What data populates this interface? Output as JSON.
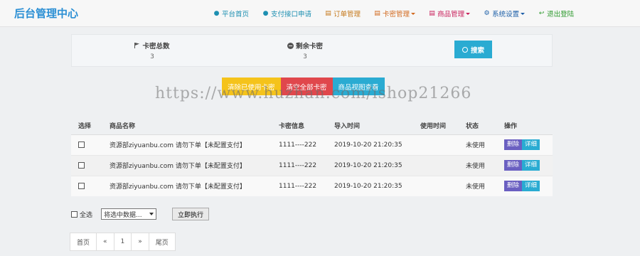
{
  "header": {
    "brand": "后台管理中心",
    "nav": [
      {
        "label": "平台首页",
        "icon": "user-icon",
        "color": "#1d8fb1",
        "dropdown": false
      },
      {
        "label": "支付接口申请",
        "icon": "user-icon",
        "color": "#1d8fb1",
        "dropdown": false
      },
      {
        "label": "订单管理",
        "icon": "order-list-icon",
        "color": "#c67a1d",
        "dropdown": false
      },
      {
        "label": "卡密管理",
        "icon": "card-list-icon",
        "color": "#d2691e",
        "dropdown": true
      },
      {
        "label": "商品管理",
        "icon": "goods-list-icon",
        "color": "#c81e5a",
        "dropdown": true
      },
      {
        "label": "系统设置",
        "icon": "gear-icon",
        "color": "#1d5fa8",
        "dropdown": true
      },
      {
        "label": "退出登陆",
        "icon": "logout-icon",
        "color": "#2d9a2d",
        "dropdown": false
      }
    ]
  },
  "stats": {
    "total": {
      "label": "卡密总数",
      "value": "3",
      "icon": "flag-icon"
    },
    "remaining": {
      "label": "剩余卡密",
      "value": "3",
      "icon": "minus-circle-icon"
    },
    "search_label": "搜索"
  },
  "actions": {
    "clear_used": {
      "label": "清除已使用卡密",
      "color": "#f5c31b"
    },
    "clear_all": {
      "label": "清空全部卡密",
      "color": "#e0474c"
    },
    "view_goods": {
      "label": "商品视图查看",
      "color": "#2aabd2"
    }
  },
  "watermark": "https://www.huzhan.com/ishop21266",
  "table": {
    "columns": [
      "选择",
      "商品名称",
      "卡密信息",
      "导入时间",
      "使用时间",
      "状态",
      "操作"
    ],
    "rows": [
      {
        "name": "资源部ziyuanbu.com 请勿下单【未配置支付】",
        "card": "1111----222",
        "import_time": "2019-10-20 21:20:35",
        "use_time": "",
        "status": "未使用",
        "delete": "删除",
        "detail": "详细"
      },
      {
        "name": "资源部ziyuanbu.com 请勿下单【未配置支付】",
        "card": "1111----222",
        "import_time": "2019-10-20 21:20:35",
        "use_time": "",
        "status": "未使用",
        "delete": "删除",
        "detail": "详细"
      },
      {
        "name": "资源部ziyuanbu.com 请勿下单【未配置支付】",
        "card": "1111----222",
        "import_time": "2019-10-20 21:20:35",
        "use_time": "",
        "status": "未使用",
        "delete": "删除",
        "detail": "详细"
      }
    ],
    "delete_color": "#6a5fc1",
    "detail_color": "#2aabd2"
  },
  "bulk": {
    "select_all": "全选",
    "select_value": "将选中数据...",
    "execute": "立即执行"
  },
  "pager": {
    "first": "首页",
    "prev": "«",
    "page": "1",
    "next": "»",
    "last": "尾页"
  }
}
